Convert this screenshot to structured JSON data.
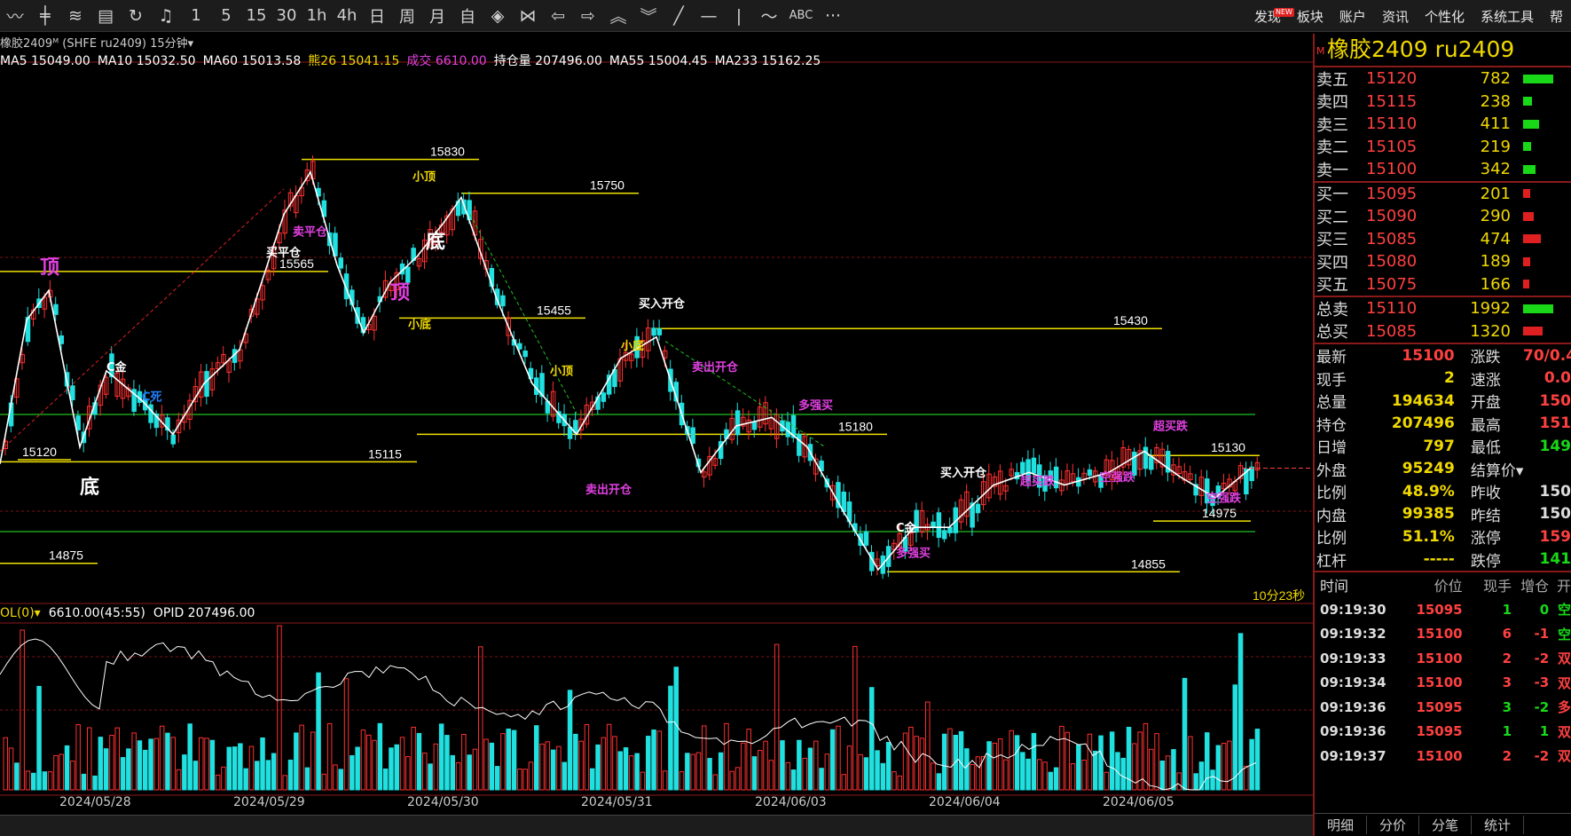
{
  "toolbar": {
    "icons": [
      "trend-line-icon",
      "kline-icon",
      "tick-icon",
      "table-icon",
      "refresh-icon",
      "alert-icon"
    ],
    "periods": [
      "1",
      "5",
      "15",
      "30",
      "1h",
      "4h",
      "日",
      "周",
      "月",
      "自"
    ],
    "draw_icons": [
      "diamond-icon",
      "cross-icon",
      "left-arrow-icon",
      "right-arrow-icon",
      "up-double-icon",
      "down-double-icon",
      "slash-icon",
      "dash-icon",
      "bar-icon",
      "zigzag-icon"
    ],
    "abc": "ABC",
    "more": "···",
    "menu": [
      "发现",
      "板块",
      "账户",
      "资讯",
      "个性化",
      "系统工具",
      "帮"
    ],
    "new_badge": "NEW"
  },
  "chart": {
    "header": "橡胶2409ᴹ (SHFE ru2409)  15分钟▾",
    "ma": [
      {
        "text": "MA5 15049.00",
        "color": "#ffffff"
      },
      {
        "text": "MA10 15032.50",
        "color": "#ffffff"
      },
      {
        "text": "MA60 15013.58",
        "color": "#ffffff"
      },
      {
        "text": "熊26 15041.15",
        "color": "#f0d800"
      },
      {
        "text": "成交 6610.00",
        "color": "#e040e0"
      },
      {
        "text": "持仓量 207496.00",
        "color": "#ffffff"
      },
      {
        "text": "MA55 15004.45",
        "color": "#ffffff"
      },
      {
        "text": "MA233 15162.25",
        "color": "#ffffff"
      }
    ],
    "ind_header": [
      {
        "text": "OL(0)▾",
        "color": "#f0d800"
      },
      {
        "text": "6610.00(45:55)",
        "color": "#ffffff"
      },
      {
        "text": "OPID 207496.00",
        "color": "#ffffff"
      }
    ],
    "levels": [
      {
        "text": "15830",
        "price": 15830
      },
      {
        "text": "15750",
        "price": 15750
      },
      {
        "text": "15565",
        "price": 15565
      },
      {
        "text": "15455",
        "price": 15455
      },
      {
        "text": "15430",
        "price": 15430
      },
      {
        "text": "15180",
        "price": 15180
      },
      {
        "text": "15130",
        "price": 15130
      },
      {
        "text": "15120",
        "price": 15120
      },
      {
        "text": "15115",
        "price": 15115
      },
      {
        "text": "14975",
        "price": 14975
      },
      {
        "text": "14875",
        "price": 14875
      },
      {
        "text": "14855",
        "price": 14855
      }
    ],
    "countdown": "10分23秒",
    "dates": [
      "2024/05/28",
      "2024/05/29",
      "2024/05/30",
      "2024/05/31",
      "2024/06/03",
      "2024/06/04",
      "2024/06/05"
    ],
    "markers": [
      {
        "text": "顶",
        "color": "#e040e0"
      },
      {
        "text": "底",
        "color": "#ffffff"
      },
      {
        "text": "小顶",
        "color": "#f0d800"
      },
      {
        "text": "小底",
        "color": "#f0d800"
      },
      {
        "text": "卖出开仓",
        "color": "#e040e0"
      },
      {
        "text": "买入开仓",
        "color": "#ffffff"
      },
      {
        "text": "超买跌",
        "color": "#e040e0"
      },
      {
        "text": "空强跌",
        "color": "#e040e0"
      },
      {
        "text": "多强买",
        "color": "#e040e0"
      },
      {
        "text": "C金",
        "color": "#ffffff"
      },
      {
        "text": "C死",
        "color": "#2080ff"
      },
      {
        "text": "买平仓",
        "color": "#ffffff"
      },
      {
        "text": "卖平仓",
        "color": "#e040e0"
      }
    ]
  },
  "panel": {
    "title": "橡胶2409  ru2409",
    "m": "M",
    "asks": [
      {
        "label": "卖五",
        "price": "15120",
        "vol": "782",
        "bar": 34
      },
      {
        "label": "卖四",
        "price": "15115",
        "vol": "238",
        "bar": 10
      },
      {
        "label": "卖三",
        "price": "15110",
        "vol": "411",
        "bar": 18
      },
      {
        "label": "卖二",
        "price": "15105",
        "vol": "219",
        "bar": 9
      },
      {
        "label": "卖一",
        "price": "15100",
        "vol": "342",
        "bar": 14
      }
    ],
    "bids": [
      {
        "label": "买一",
        "price": "15095",
        "vol": "201",
        "bar": 8
      },
      {
        "label": "买二",
        "price": "15090",
        "vol": "290",
        "bar": 12
      },
      {
        "label": "买三",
        "price": "15085",
        "vol": "474",
        "bar": 20
      },
      {
        "label": "买四",
        "price": "15080",
        "vol": "189",
        "bar": 8
      },
      {
        "label": "买五",
        "price": "15075",
        "vol": "166",
        "bar": 7
      }
    ],
    "totals": [
      {
        "label": "总卖",
        "price": "15110",
        "vol": "1992",
        "bar": 34,
        "color": "#18d818"
      },
      {
        "label": "总买",
        "price": "15085",
        "vol": "1320",
        "bar": 22,
        "color": "#e02020"
      }
    ],
    "stats": [
      {
        "l": "最新",
        "v": "15100",
        "vc": "#ff4040",
        "l2": "涨跌",
        "v2": "70/0.4",
        "v2c": "#ff4040"
      },
      {
        "l": "现手",
        "v": "2",
        "vc": "#f0d800",
        "l2": "速涨",
        "v2": "0.0",
        "v2c": "#ff4040"
      },
      {
        "l": "总量",
        "v": "194634",
        "vc": "#f0d800",
        "l2": "开盘",
        "v2": "150",
        "v2c": "#ff4040"
      },
      {
        "l": "持仓",
        "v": "207496",
        "vc": "#f0d800",
        "l2": "最高",
        "v2": "151",
        "v2c": "#ff4040"
      },
      {
        "l": "日增",
        "v": "797",
        "vc": "#f0d800",
        "l2": "最低",
        "v2": "149",
        "v2c": "#18d818"
      },
      {
        "l": "外盘",
        "v": "95249",
        "vc": "#f0d800",
        "l2": "结算价▾",
        "v2": "",
        "v2c": "#ddd"
      },
      {
        "l": "比例",
        "v": "48.9%",
        "vc": "#f0d800",
        "l2": "昨收",
        "v2": "150",
        "v2c": "#ddd"
      },
      {
        "l": "内盘",
        "v": "99385",
        "vc": "#f0d800",
        "l2": "昨结",
        "v2": "150",
        "v2c": "#ddd"
      },
      {
        "l": "比例",
        "v": "51.1%",
        "vc": "#f0d800",
        "l2": "涨停",
        "v2": "159",
        "v2c": "#ff4040"
      },
      {
        "l": "杠杆",
        "v": "-----",
        "vc": "#f0d800",
        "l2": "跌停",
        "v2": "141",
        "v2c": "#18d818"
      }
    ],
    "tick_head": [
      "时间",
      "价位",
      "现手",
      "增仓",
      "开"
    ],
    "ticks": [
      {
        "time": "09:19:30",
        "price": "15095",
        "qty": "1",
        "qc": "#18d818",
        "add": "0",
        "type": "空",
        "tc": "#18d818"
      },
      {
        "time": "09:19:32",
        "price": "15100",
        "qty": "6",
        "qc": "#ff4040",
        "add": "-1",
        "type": "空",
        "tc": "#18d818"
      },
      {
        "time": "09:19:33",
        "price": "15100",
        "qty": "2",
        "qc": "#ff4040",
        "add": "-2",
        "type": "双",
        "tc": "#ff4040"
      },
      {
        "time": "09:19:34",
        "price": "15100",
        "qty": "3",
        "qc": "#ff4040",
        "add": "-3",
        "type": "双",
        "tc": "#ff4040"
      },
      {
        "time": "09:19:36",
        "price": "15095",
        "qty": "3",
        "qc": "#18d818",
        "add": "-2",
        "type": "多",
        "tc": "#ff4040"
      },
      {
        "time": "09:19:36",
        "price": "15095",
        "qty": "1",
        "qc": "#18d818",
        "add": "1",
        "type": "双",
        "tc": "#ff4040"
      },
      {
        "time": "09:19:37",
        "price": "15100",
        "qty": "2",
        "qc": "#ff4040",
        "add": "-2",
        "type": "双",
        "tc": "#ff4040"
      }
    ],
    "tabs": [
      "明细",
      "分价",
      "分笔",
      "统计"
    ]
  }
}
